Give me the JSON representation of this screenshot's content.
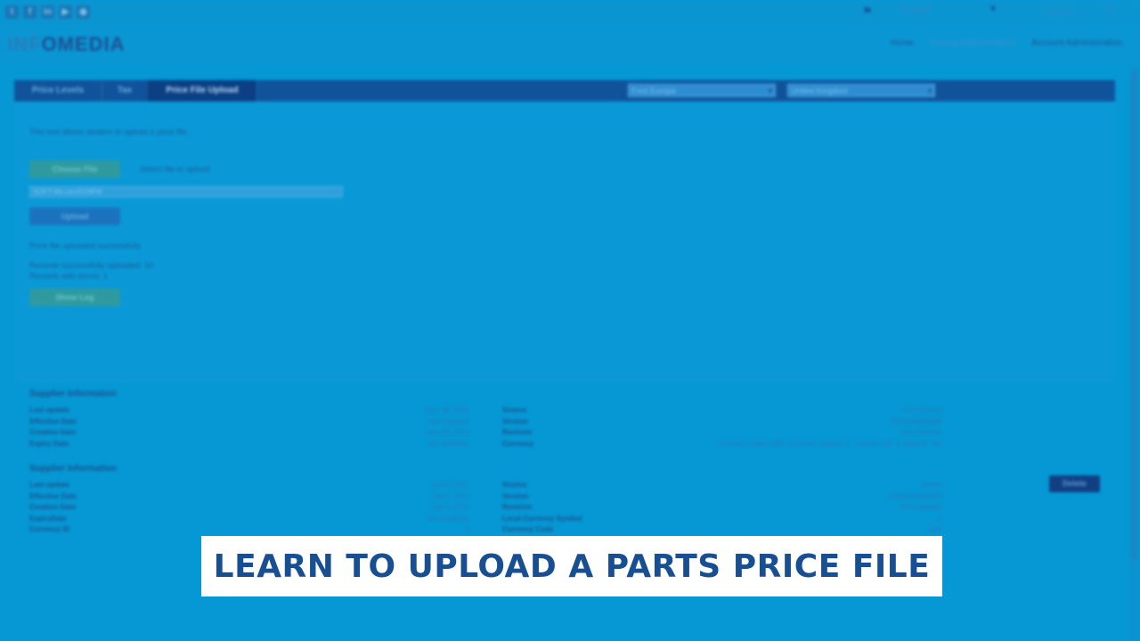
{
  "topbar": {
    "social_icons": [
      {
        "name": "twitter-icon",
        "glyph": "t"
      },
      {
        "name": "facebook-icon",
        "glyph": "f"
      },
      {
        "name": "linkedin-icon",
        "glyph": "in"
      },
      {
        "name": "youtube-icon",
        "glyph": "▶"
      },
      {
        "name": "rss-icon",
        "glyph": "◉"
      }
    ],
    "language_value": "English",
    "logout_label": "Log Out"
  },
  "header": {
    "logo_prefix": "INF",
    "logo_mid": "O",
    "logo_suffix": "MEDIA",
    "nav": [
      {
        "label": "Home",
        "active": false
      },
      {
        "label": "Pricing Administration",
        "active": true
      },
      {
        "label": "Account Administration",
        "active": false
      }
    ]
  },
  "tabs": [
    {
      "label": "Price Levels",
      "active": false
    },
    {
      "label": "Tax",
      "active": false
    },
    {
      "label": "Price File Upload",
      "active": true
    }
  ],
  "filters": {
    "region_value": "Ford Europe",
    "country_value": "United Kingdom"
  },
  "upload": {
    "description": "This tool allows dealers to upload a price file.",
    "choose_button": "Choose File",
    "select_label": "Select file to upload",
    "file_value": "SOFT-file.csv2019FM",
    "upload_button": "Upload",
    "success_message": "Price file uploaded successfully.",
    "records_ok": "Records successfully uploaded: 10",
    "records_err": "Records with errors: 1",
    "log_button": "Show Log"
  },
  "supplier_sections": [
    {
      "title": "Supplier Information",
      "left": [
        {
          "k": "Last update",
          "v": "June 08, 2021"
        },
        {
          "k": "Effective Date",
          "v": "Not Available"
        },
        {
          "k": "Creation Date",
          "v": "June 03, 2021"
        },
        {
          "k": "Expiry Date",
          "v": "Not Available"
        }
      ],
      "right": [
        {
          "k": "Source",
          "v": "Ford Europe"
        },
        {
          "k": "Version",
          "v": "2021060800000"
        },
        {
          "k": "Revision",
          "v": "Not Available"
        },
        {
          "k": "Currency",
          "v": "Currency Code: GBP, Currency Symbol: £, Currency ID: 2, Default: Yes"
        }
      ]
    },
    {
      "title": "Supplier Information",
      "left": [
        {
          "k": "Last update",
          "v": "July 5, 2021"
        },
        {
          "k": "Effective Date",
          "v": "July 5, 2021"
        },
        {
          "k": "Creation Date",
          "v": "July 5, 2021"
        },
        {
          "k": "ExpiryDate",
          "v": "Not Available"
        },
        {
          "k": "Currency ID",
          "v": "2"
        }
      ],
      "right": [
        {
          "k": "Source",
          "v": "Dealer"
        },
        {
          "k": "Version",
          "v": "20210705000000"
        },
        {
          "k": "Revision",
          "v": "Not Available"
        },
        {
          "k": "Local Currency Symbol",
          "v": "£"
        },
        {
          "k": "Currency Code",
          "v": "GBP"
        }
      ]
    }
  ],
  "delete_button": "Delete",
  "overlay_title": "LEARN TO UPLOAD A PARTS PRICE FILE",
  "colors": {
    "background": "#0698d4",
    "tabbar": "#10539a",
    "overlay_text": "#174f92"
  }
}
